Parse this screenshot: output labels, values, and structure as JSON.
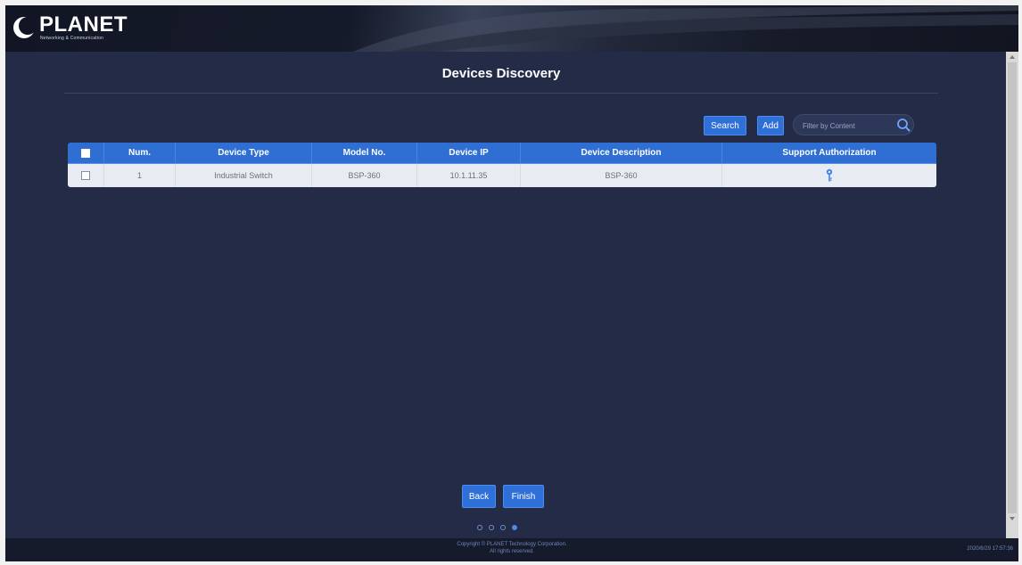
{
  "header": {
    "logo_text": "PLANET",
    "logo_subtext": "Networking & Communication"
  },
  "page": {
    "title": "Devices Discovery"
  },
  "toolbar": {
    "search_label": "Search",
    "add_label": "Add",
    "filter_placeholder": "Filter by Content"
  },
  "table": {
    "columns": [
      "Num.",
      "Device Type",
      "Model No.",
      "Device IP",
      "Device Description",
      "Support Authorization"
    ],
    "rows": [
      {
        "num": "1",
        "device_type": "Industrial Switch",
        "model_no": "BSP-360",
        "device_ip": "10.1.11.35",
        "device_description": "BSP-360",
        "support_authorization_icon": "key-icon"
      }
    ]
  },
  "actions": {
    "back_label": "Back",
    "finish_label": "Finish"
  },
  "wizard": {
    "total_steps": 4,
    "current_step": 4
  },
  "footer": {
    "copyright_line1": "Copyright © PLANET Technology Corporation.",
    "copyright_line2": "All rights reserved.",
    "clock": "2020/6/29 17:57:36"
  },
  "colors": {
    "background": "#232b47",
    "accent": "#2e6fd8",
    "table_header": "#2f6fd4",
    "table_row": "#e8ecf2"
  }
}
